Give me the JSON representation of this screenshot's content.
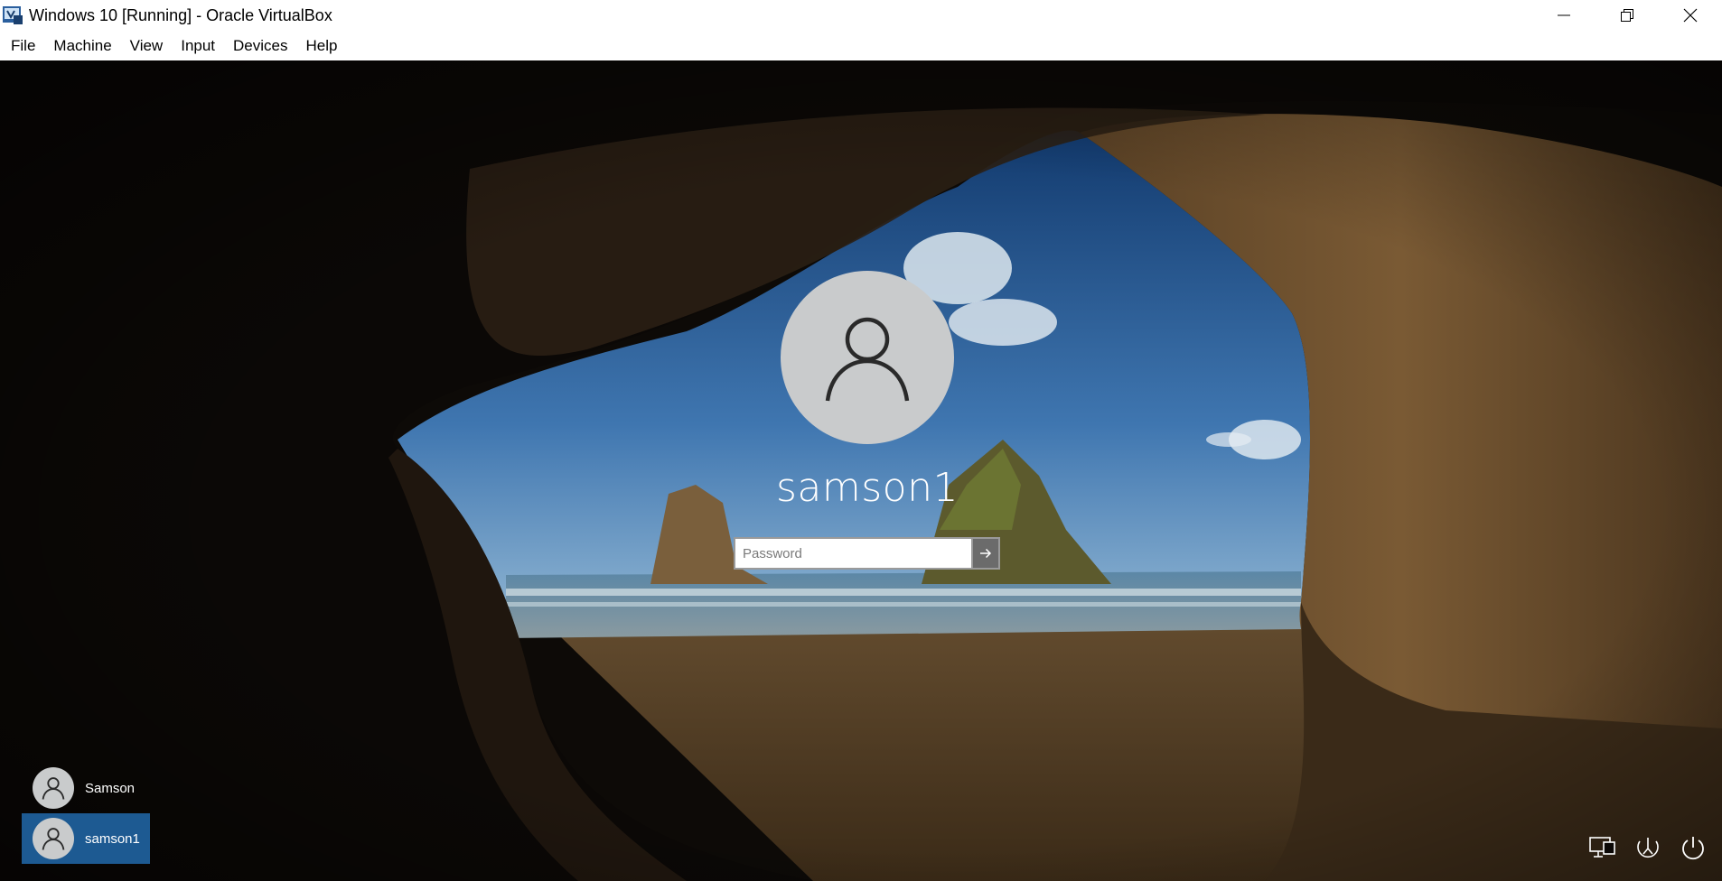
{
  "window": {
    "title": "Windows 10 [Running] - Oracle VirtualBox",
    "icon": "virtualbox-icon",
    "controls": [
      "minimize-icon",
      "restore-icon",
      "close-icon"
    ]
  },
  "menu": {
    "items": [
      "File",
      "Machine",
      "View",
      "Input",
      "Devices",
      "Help"
    ]
  },
  "login": {
    "current_user": "samson1",
    "password_placeholder": "Password",
    "submit_icon": "arrow-right-icon",
    "avatar_icon": "user-icon"
  },
  "users": [
    {
      "name": "Samson",
      "selected": false
    },
    {
      "name": "samson1",
      "selected": true
    }
  ],
  "tray": {
    "icons": [
      "network-icon",
      "ease-of-access-icon",
      "power-icon"
    ]
  },
  "colors": {
    "selected_user_bg": "#1d5a92",
    "avatar_bg": "#c9cbcc"
  }
}
